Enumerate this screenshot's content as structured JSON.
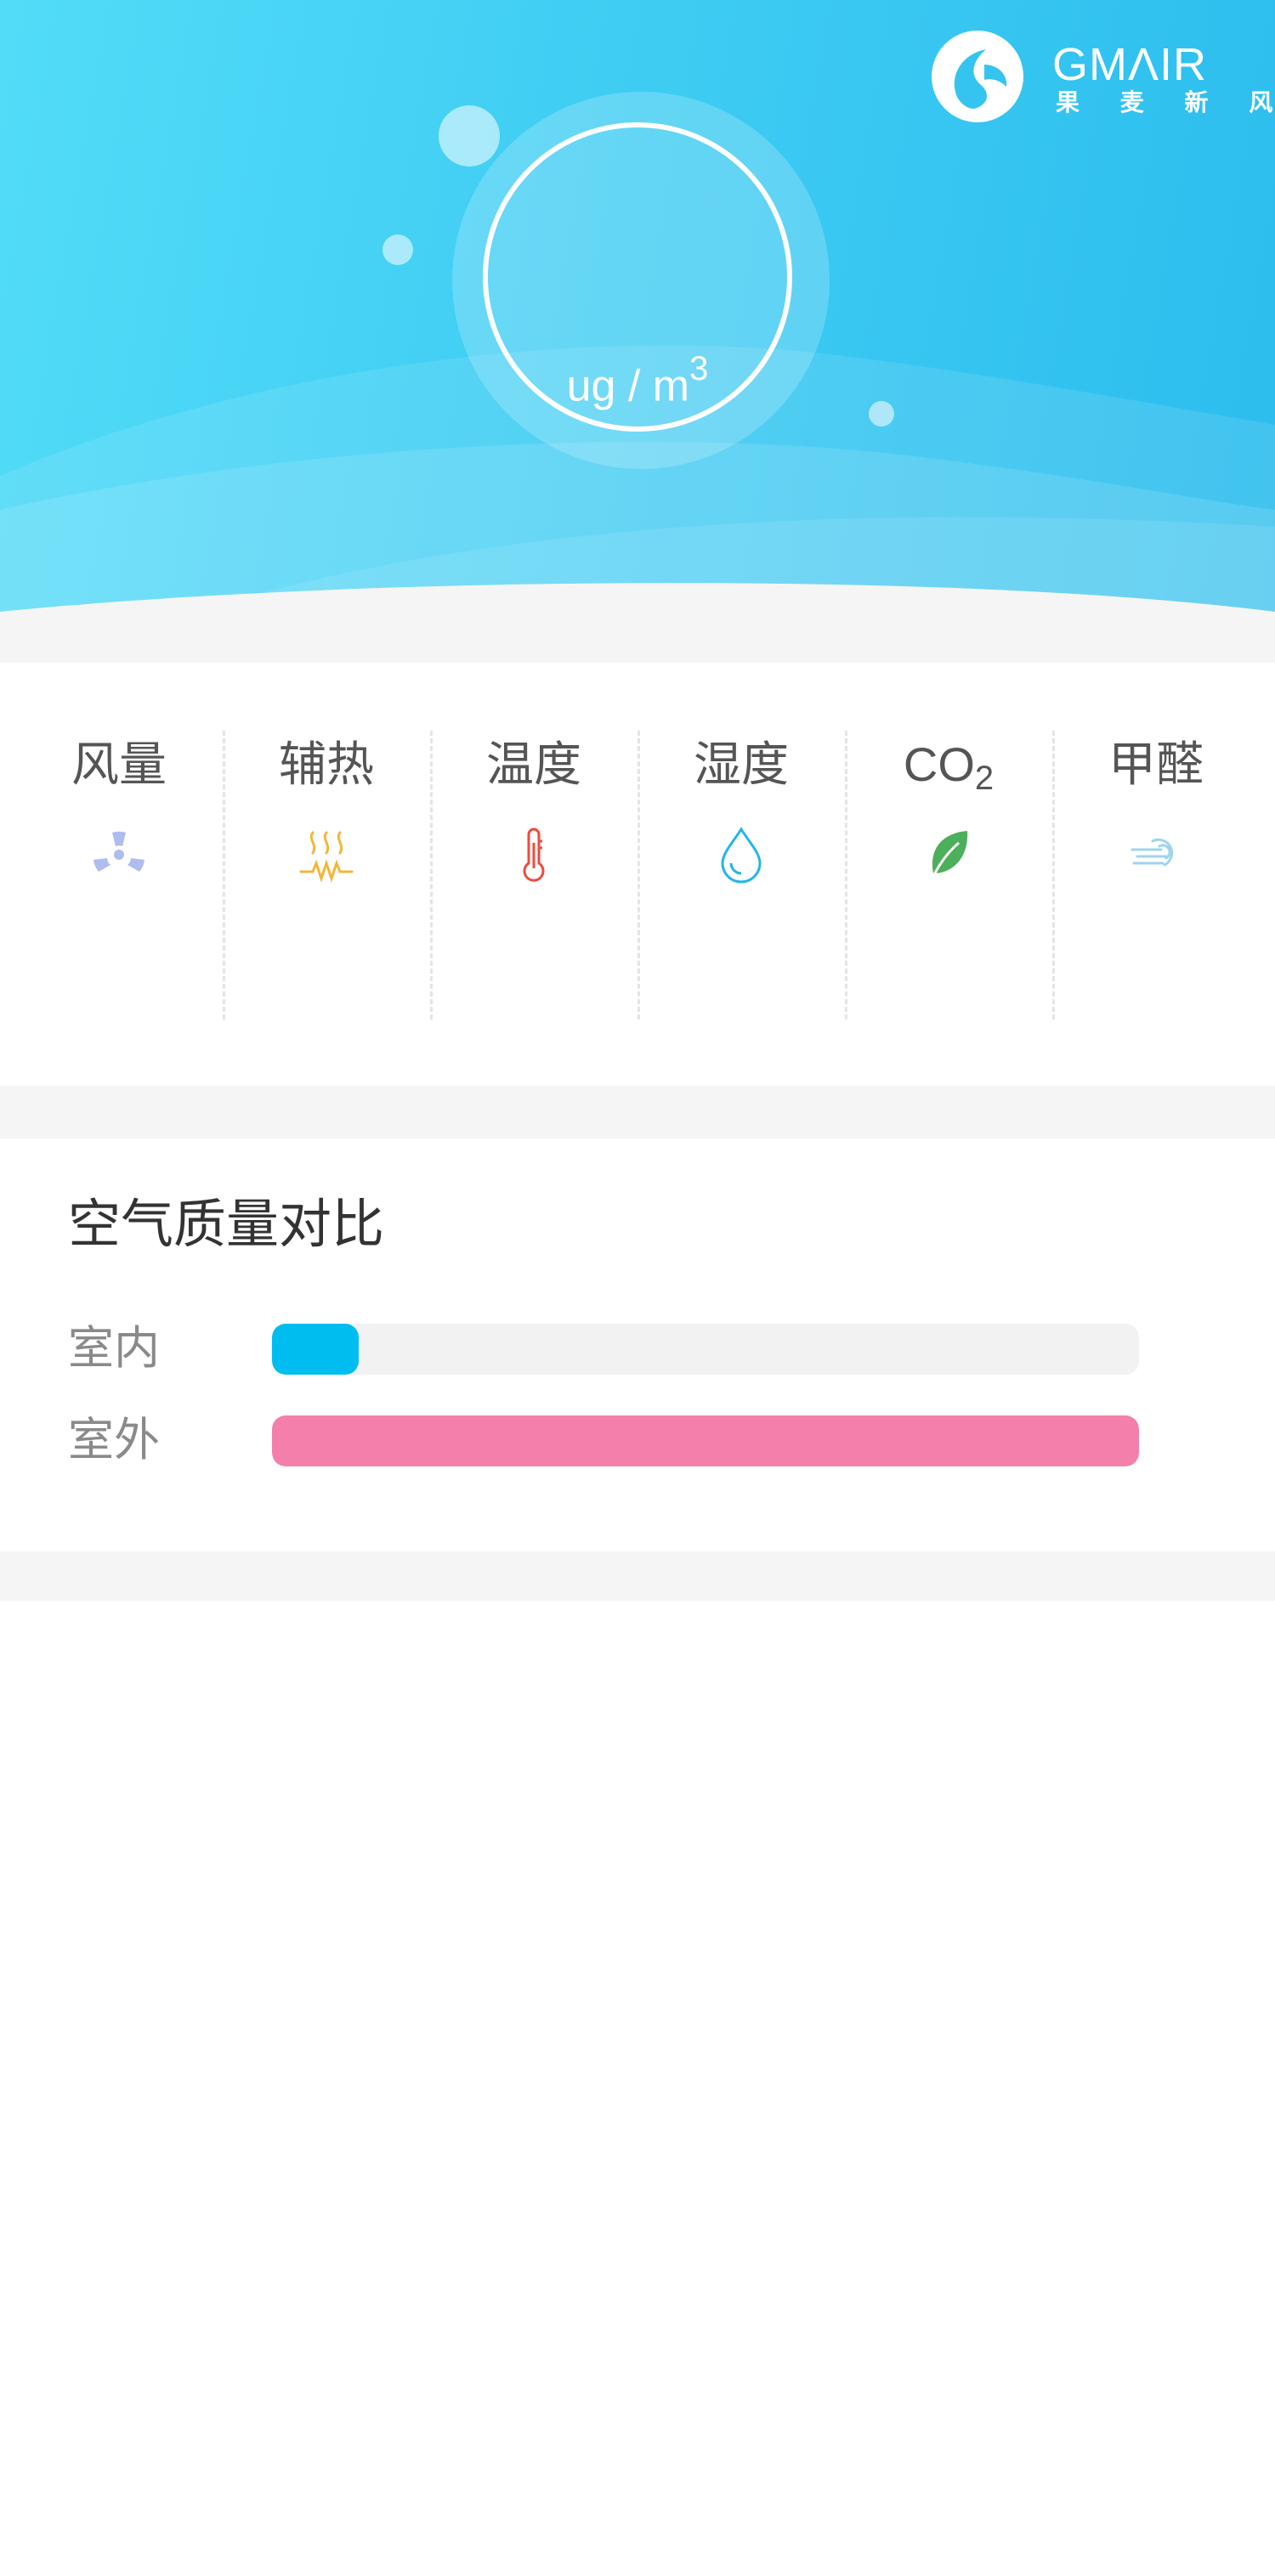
{
  "header": {
    "unit_text": "ug / m",
    "unit_superscript": "3",
    "logo_text": "GMΛIR",
    "logo_subtitle": "果 麦 新 风",
    "gradient_colors": [
      "#52dcf8",
      "#2cbdee"
    ]
  },
  "metrics": [
    {
      "label": "风量",
      "icon": "fan-icon",
      "color": "#aebcf0"
    },
    {
      "label": "辅热",
      "icon": "heater-icon",
      "color": "#f2b63a"
    },
    {
      "label": "温度",
      "icon": "thermometer-icon",
      "color": "#ef4b3c"
    },
    {
      "label": "湿度",
      "icon": "water-drop-icon",
      "color": "#23b6e6"
    },
    {
      "label": "CO",
      "label_sub": "2",
      "icon": "leaf-icon",
      "color": "#4caf5a"
    },
    {
      "label": "甲醛",
      "icon": "wind-icon",
      "color": "#9fd4ec"
    }
  ],
  "comparison": {
    "title": "空气质量对比",
    "rows": [
      {
        "label": "室内",
        "fill": 0.1,
        "color": "#00bdf0"
      },
      {
        "label": "室外",
        "fill": 1.0,
        "color": "#f47fab"
      }
    ]
  }
}
